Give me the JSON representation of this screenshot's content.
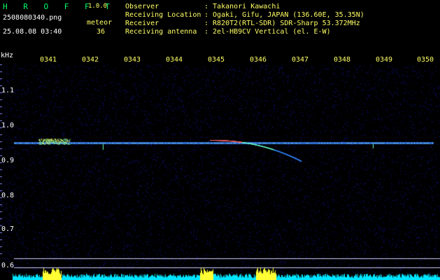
{
  "app": {
    "name": "H R O F F T",
    "version": "1.0.0"
  },
  "file": {
    "name": "2508080340.png",
    "datetime": "25.08.08 03:40"
  },
  "meteor": {
    "label": "meteor",
    "count": "36"
  },
  "info": [
    {
      "label": "Observer",
      "value": ": Takanori Kawachi"
    },
    {
      "label": "Receiving Location",
      "value": ": Ogaki, Gifu, JAPAN (136.60E, 35.35N)"
    },
    {
      "label": "Receiver",
      "value": ": R820T2(RTL-SDR) SDR-Sharp 53.372MHz"
    },
    {
      "label": "Receiving antenna",
      "value": ": 2el-HB9CV Vertical (el. E-W)"
    }
  ],
  "axis": {
    "y_unit": "kHz",
    "y_ticks": [
      "1.1",
      "1.0",
      "0.9",
      "0.8",
      "0.7",
      "0.6"
    ],
    "x_ticks": [
      "0341",
      "0342",
      "0343",
      "0344",
      "0345",
      "0346",
      "0347",
      "0348",
      "0349",
      "0350"
    ]
  },
  "colors": {
    "background": "#000000",
    "noise": "#1a1a8a",
    "carrier": "#3a7bd5",
    "meteor_trail": "#33cc99",
    "bottom_band": "#00e5ff",
    "bottom_peak": "#ffff33"
  }
}
